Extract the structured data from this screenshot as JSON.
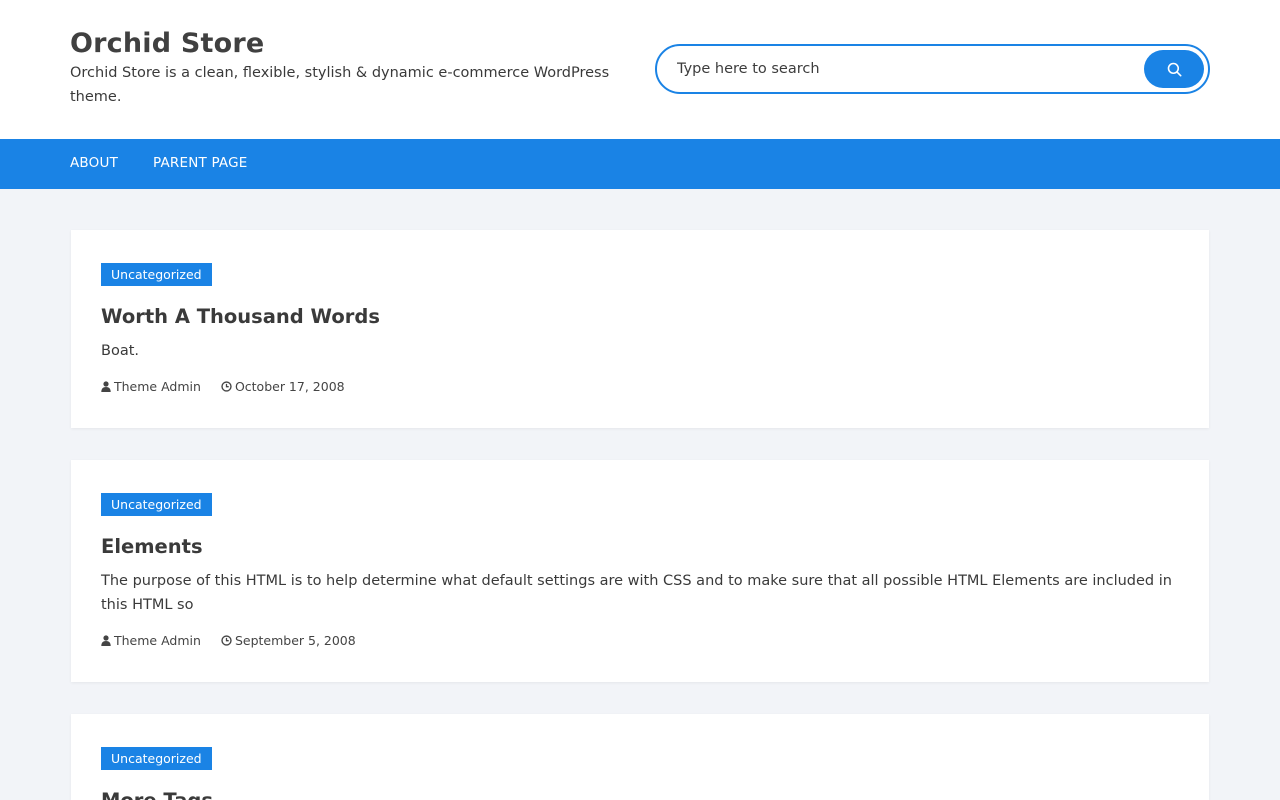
{
  "site": {
    "title": "Orchid Store",
    "description": "Orchid Store is a clean, flexible, stylish & dynamic e-commerce WordPress theme."
  },
  "search": {
    "placeholder": "Type here to search"
  },
  "nav": {
    "items": [
      {
        "label": "ABOUT"
      },
      {
        "label": "PARENT PAGE"
      }
    ]
  },
  "posts": [
    {
      "category": "Uncategorized",
      "title": "Worth A Thousand Words",
      "excerpt": "Boat.",
      "author": "Theme Admin",
      "date": "October 17, 2008"
    },
    {
      "category": "Uncategorized",
      "title": "Elements",
      "excerpt": "The purpose of this HTML is to help determine what default settings are with CSS and to make sure that all possible HTML Elements are included in this HTML so",
      "author": "Theme Admin",
      "date": "September 5, 2008"
    },
    {
      "category": "Uncategorized",
      "title": "More Tags"
    }
  ],
  "icons": {
    "search": "search-icon",
    "author": "user-icon",
    "date": "clock-icon"
  },
  "colors": {
    "accent": "#1a83e5",
    "page_background": "#f2f4f8",
    "card_background": "#ffffff",
    "text": "#3a3a3a"
  }
}
